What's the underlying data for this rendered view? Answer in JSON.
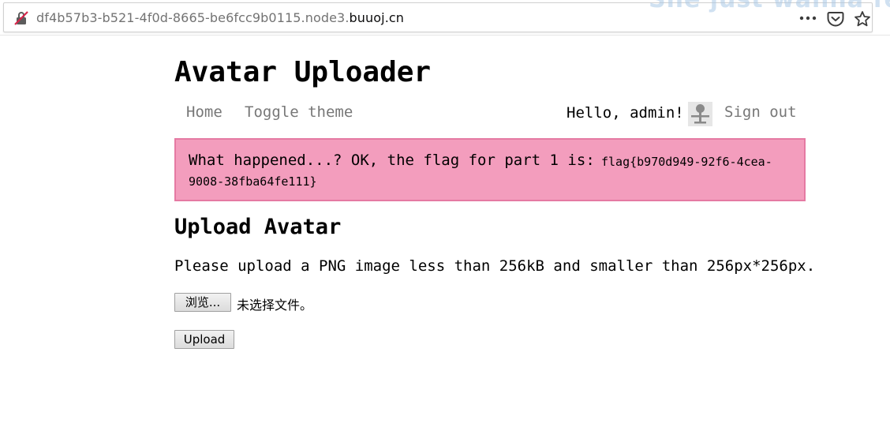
{
  "browser": {
    "url_prefix": "df4b57b3-b521-4f0d-8665-be6fcc9b0115.node3.",
    "url_domain": "buuoj.cn",
    "overlay_text": "She just wanna fee",
    "icons": [
      "insecure-lock-icon",
      "more-icon",
      "pocket-icon",
      "bookmark-star-icon"
    ]
  },
  "site": {
    "title": "Avatar Uploader"
  },
  "nav": {
    "home": "Home",
    "toggle_theme": "Toggle theme",
    "greeting": "Hello, admin!",
    "sign_out": "Sign out"
  },
  "alert": {
    "message": "What happened...? OK, the flag for part 1 is:",
    "flag_line1": "flag{b970d949-92f6-4cea-",
    "flag_line2": "9008-38fba64fe111}",
    "background_color": "#f39dbd",
    "border_color": "#e57aa3"
  },
  "upload": {
    "heading": "Upload Avatar",
    "instructions": "Please upload a PNG image less than 256kB and smaller than 256px*256px.",
    "browse_label": "浏览...",
    "no_file_text": "未选择文件。",
    "submit_label": "Upload"
  }
}
